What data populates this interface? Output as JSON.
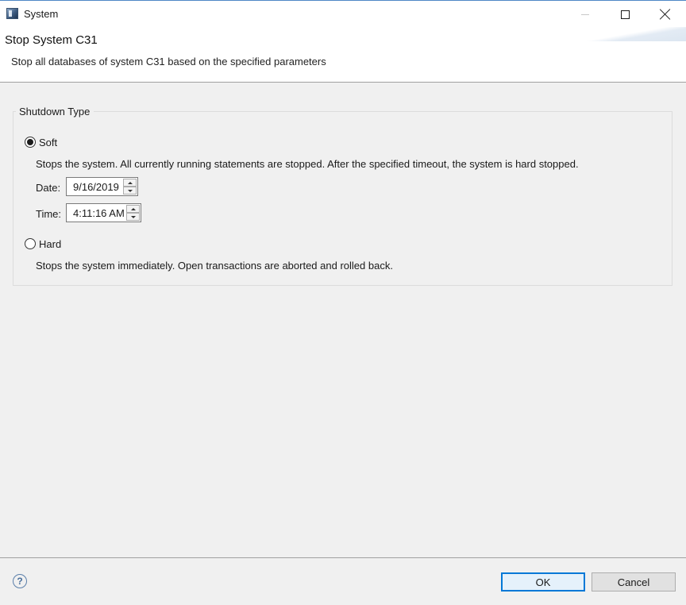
{
  "window": {
    "title": "System",
    "icon": "app-icon"
  },
  "header": {
    "title": "Stop System C31",
    "description": "Stop all databases of system C31 based on the specified parameters"
  },
  "shutdown": {
    "legend": "Shutdown Type",
    "soft": {
      "label": "Soft",
      "selected": true,
      "description": "Stops the system. All currently running statements are stopped. After the specified timeout, the system is hard stopped.",
      "date_label": "Date:",
      "date_value": "9/16/2019",
      "time_label": "Time:",
      "time_value": "4:11:16 AM"
    },
    "hard": {
      "label": "Hard",
      "selected": false,
      "description": "Stops the system immediately. Open transactions are aborted and rolled back."
    }
  },
  "footer": {
    "help_glyph": "?",
    "ok_label": "OK",
    "cancel_label": "Cancel"
  },
  "colors": {
    "default_button_border": "#0078d7",
    "title_accent": "#4f88c6"
  }
}
